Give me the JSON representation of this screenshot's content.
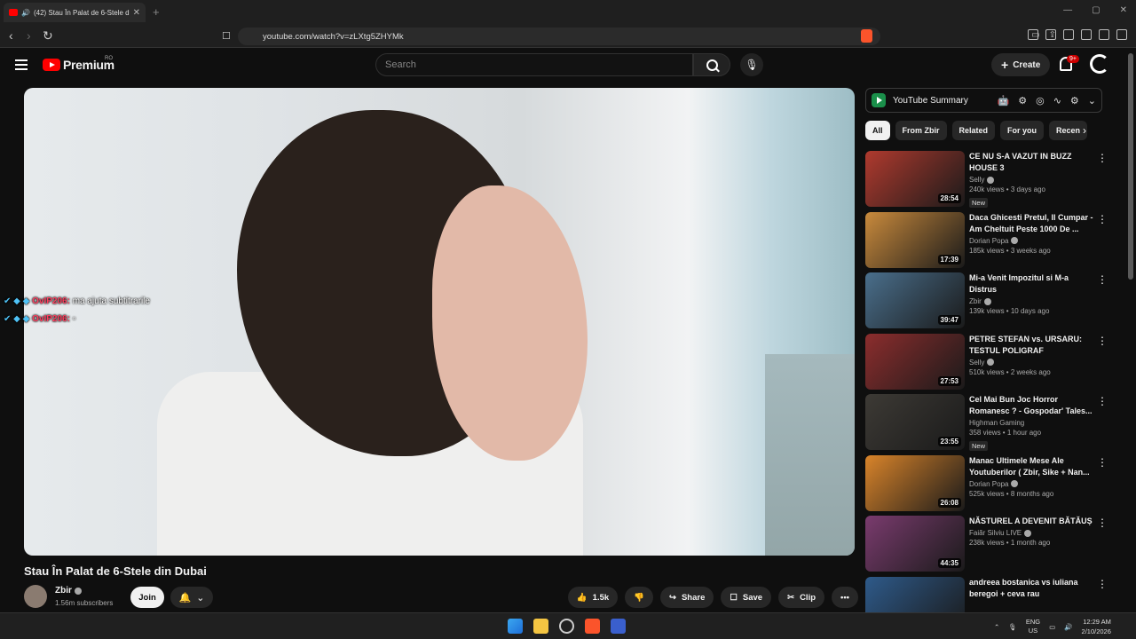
{
  "browser": {
    "tab_title": "(42) Stau În Palat de 6-Stele din Dubai",
    "tab_close": "✕",
    "new_tab": "+",
    "url": "youtube.com/watch?v=zLXtg5ZHYMk",
    "window_controls": [
      "—",
      "▢",
      "✕"
    ]
  },
  "youtube": {
    "logo_text": "Premium",
    "region": "RO",
    "search_placeholder": "Search",
    "create_label": "Create",
    "notifications_badge": "9+"
  },
  "video": {
    "chat": [
      {
        "user": "OvIP206:",
        "message": "ma ajuta subtitrarile"
      },
      {
        "user": "OvIP206:",
        "message": ""
      }
    ],
    "title": "Stau În Palat de 6-Stele din Dubai",
    "channel": "Zbir",
    "subscribers": "1.56m subscribers",
    "join_label": "Join",
    "likes": "1.5k",
    "share_label": "Share",
    "save_label": "Save",
    "clip_label": "Clip"
  },
  "extension": {
    "title": "YouTube Summary"
  },
  "chips": [
    "All",
    "From Zbir",
    "Related",
    "For you",
    "Recen"
  ],
  "recommendations": [
    {
      "title": "CE NU S-A VAZUT IN BUZZ HOUSE 3",
      "channel": "Selly",
      "verified": true,
      "meta": "240k views • 3 days ago",
      "duration": "28:54",
      "new": "New",
      "color": "#b03a2e"
    },
    {
      "title": "Daca Ghicesti Pretul, Il Cumpar - Am Cheltuit Peste 1000 De ...",
      "channel": "Dorian Popa",
      "verified": true,
      "meta": "185k views • 3 weeks ago",
      "duration": "17:39",
      "new": "",
      "color": "#c98a3c"
    },
    {
      "title": "Mi-a Venit Impozitul si M-a Distrus",
      "channel": "Zbir",
      "verified": true,
      "meta": "139k views • 10 days ago",
      "duration": "39:47",
      "new": "",
      "color": "#4a6f8c"
    },
    {
      "title": "PETRE STEFAN vs. URSARU: TESTUL POLIGRAF (Detectorul...",
      "channel": "Selly",
      "verified": true,
      "meta": "510k views • 2 weeks ago",
      "duration": "27:53",
      "new": "",
      "color": "#8c2d2d"
    },
    {
      "title": "Cel Mai Bun Joc Horror Romanesc ? - Gospodar' Tales...",
      "channel": "Highman Gaming",
      "verified": false,
      "meta": "358 views • 1 hour ago",
      "duration": "23:55",
      "new": "New",
      "color": "#3d3a35"
    },
    {
      "title": "Manac Ultimele Mese Ale Youtuberilor ( Zbir, Sike + Nan...",
      "channel": "Dorian Popa",
      "verified": true,
      "meta": "525k views • 8 months ago",
      "duration": "26:08",
      "new": "",
      "color": "#d9842a"
    },
    {
      "title": "NĂSTUREL A DEVENIT BĂTĂUȘ",
      "channel": "Faiăr Silviu LIVE",
      "verified": true,
      "meta": "238k views • 1 month ago",
      "duration": "44:35",
      "new": "",
      "color": "#7a3b6e"
    },
    {
      "title": "andreea bostanica vs iuliana beregoi + ceva rau",
      "channel": "",
      "verified": false,
      "meta": "",
      "duration": "",
      "new": "",
      "color": "#2e5a8a"
    }
  ],
  "taskbar": {
    "lang": "ENG",
    "region": "US",
    "time": "12:29 AM",
    "date": "2/10/2026"
  }
}
